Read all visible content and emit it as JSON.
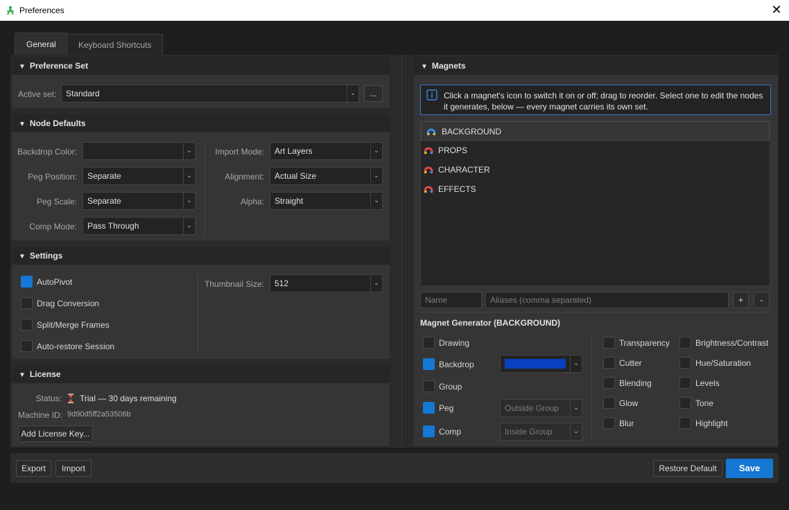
{
  "window": {
    "title": "Preferences"
  },
  "tabs": [
    {
      "label": "General"
    },
    {
      "label": "Keyboard Shortcuts"
    }
  ],
  "preference_set": {
    "title": "Preference Set",
    "active_set_label": "Active set:",
    "active_set_value": "Standard",
    "more_button": "..."
  },
  "node_defaults": {
    "title": "Node Defaults",
    "backdrop_color_label": "Backdrop Color:",
    "backdrop_color_value": "",
    "peg_position_label": "Peg Position:",
    "peg_position_value": "Separate",
    "peg_scale_label": "Peg Scale:",
    "peg_scale_value": "Separate",
    "comp_mode_label": "Comp Mode:",
    "comp_mode_value": "Pass Through",
    "import_mode_label": "Import Mode:",
    "import_mode_value": "Art Layers",
    "alignment_label": "Alignment:",
    "alignment_value": "Actual Size",
    "alpha_label": "Alpha:",
    "alpha_value": "Straight"
  },
  "settings": {
    "title": "Settings",
    "checkboxes": [
      {
        "label": "AutoPivot",
        "checked": true
      },
      {
        "label": "Drag Conversion",
        "checked": false
      },
      {
        "label": "Split/Merge Frames",
        "checked": false
      },
      {
        "label": "Auto-restore Session",
        "checked": false
      }
    ],
    "thumbnail_size_label": "Thumbnail Size:",
    "thumbnail_size_value": "512"
  },
  "license": {
    "title": "License",
    "status_label": "Status:",
    "status_icon": "hourglass-icon",
    "status_value": "Trial — 30 days remaining",
    "machine_id_label": "Machine ID:",
    "machine_id_value": "9d90d5ff2a53506b",
    "add_key_button": "Add License Key..."
  },
  "magnets": {
    "title": "Magnets",
    "info_text": "Click a magnet's icon to switch it on or off; drag to reorder. Select one to edit the nodes it generates, below — every magnet carries its own set.",
    "items": [
      {
        "label": "BACKGROUND",
        "selected": true
      },
      {
        "label": "PROPS",
        "selected": false
      },
      {
        "label": "CHARACTER",
        "selected": false
      },
      {
        "label": "EFFECTS",
        "selected": false
      }
    ],
    "name_placeholder": "Name",
    "aliases_placeholder": "Aliases (comma separated)",
    "add_button": "+",
    "remove_button": "-"
  },
  "magnet_generator": {
    "title": "Magnet Generator (BACKGROUND)",
    "drawing_label": "Drawing",
    "drawing_checked": false,
    "backdrop_label": "Backdrop",
    "backdrop_checked": true,
    "backdrop_color": "#0a3fbf",
    "group_label": "Group",
    "group_checked": false,
    "peg_label": "Peg",
    "peg_checked": true,
    "peg_value": "Outside Group",
    "comp_label": "Comp",
    "comp_checked": true,
    "comp_value": "Inside Group",
    "effects_col1": [
      {
        "label": "Transparency",
        "checked": false
      },
      {
        "label": "Cutter",
        "checked": false
      },
      {
        "label": "Blending",
        "checked": false
      },
      {
        "label": "Glow",
        "checked": false
      },
      {
        "label": "Blur",
        "checked": false
      }
    ],
    "effects_col2": [
      {
        "label": "Brightness/Contrast",
        "checked": false
      },
      {
        "label": "Hue/Saturation",
        "checked": false
      },
      {
        "label": "Levels",
        "checked": false
      },
      {
        "label": "Tone",
        "checked": false
      },
      {
        "label": "Highlight",
        "checked": false
      }
    ]
  },
  "footer": {
    "export_button": "Export",
    "import_button": "Import",
    "restore_button": "Restore Default",
    "save_button": "Save"
  },
  "colors": {
    "accent": "#1478d4",
    "background": "#1e1e1e",
    "panel": "#333333"
  }
}
